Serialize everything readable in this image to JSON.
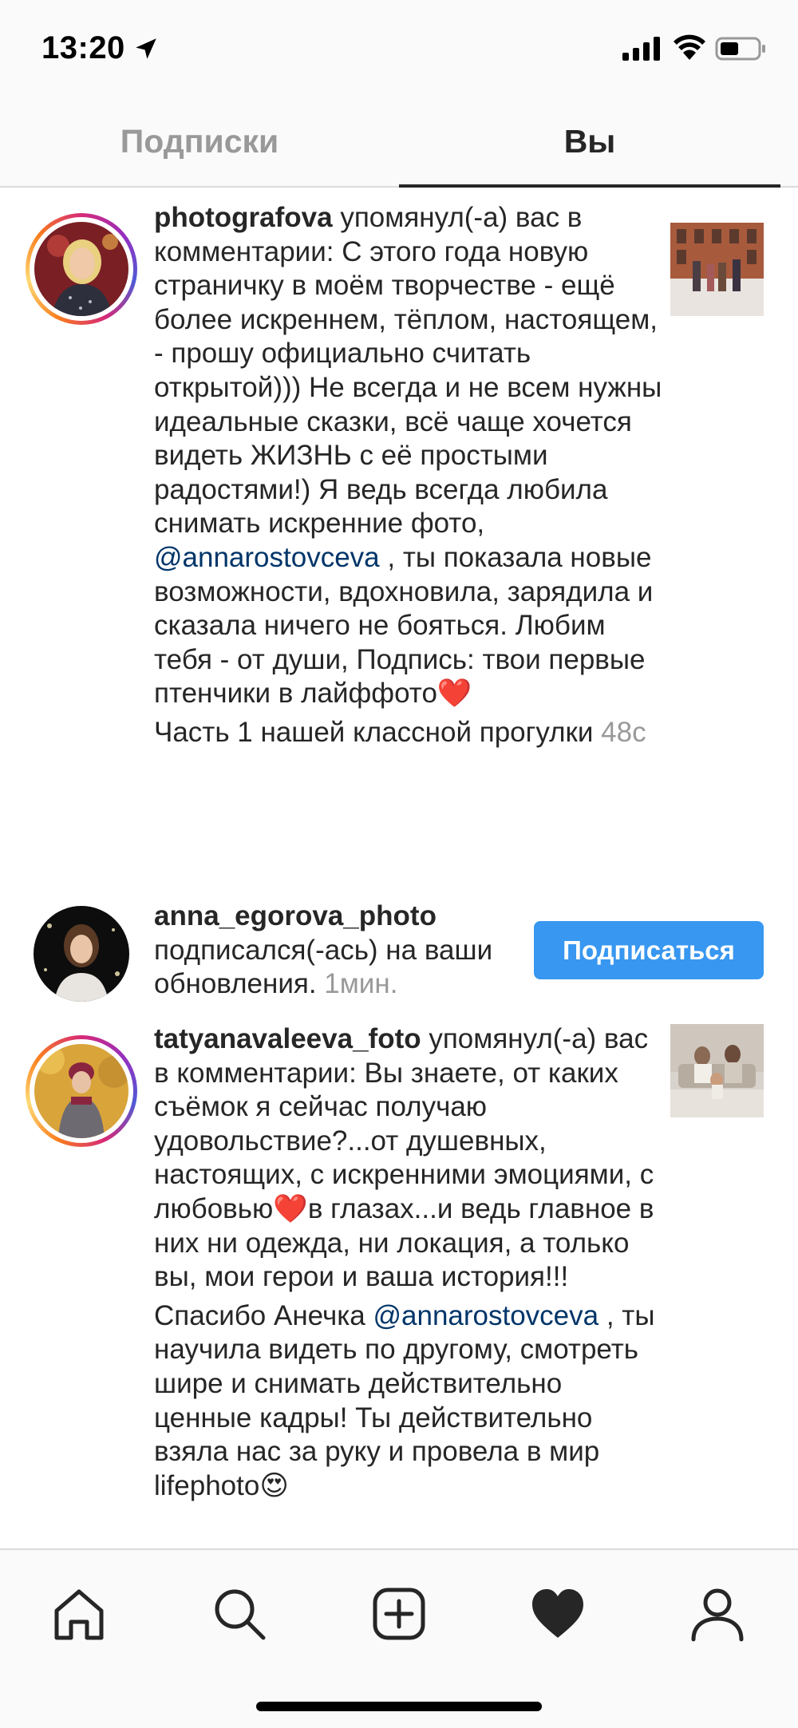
{
  "status_bar": {
    "time": "13:20"
  },
  "tabs": [
    {
      "label": "Подписки",
      "active": false
    },
    {
      "label": "Вы",
      "active": true
    }
  ],
  "activity": [
    {
      "username": "photografova",
      "action": "упомянул(-а) вас в комментарии:",
      "text_1": "С этого года новую страничку в моём творчестве - ещё более искреннем, тёплом, настоящем, - прошу официально считать открытой))) Не всегда и не всем нужны идеальные сказки, всё чаще хочется видеть ЖИЗНЬ с её простыми радостями!) Я ведь всегда любила снимать искренние фото,",
      "mention": "@annarostovceva",
      "text_2": ", ты показала новые возможности, вдохновила, зарядила и сказала ничего не бояться. Любим тебя - от души, Подпись: твои первые птенчики в лайффото",
      "emoji": "❤️",
      "text_3": "Часть 1 нашей классной прогулки",
      "time": "48с"
    },
    {
      "username": "anna_egorova_photo",
      "action": "подписался(-ась) на ваши обновления.",
      "time": "1мин.",
      "button_label": "Подписаться"
    },
    {
      "username": "tatyanavaleeva_foto",
      "action": "упомянул(-а) вас в комментарии:",
      "text_1": "Вы знаете, от каких съёмок я сейчас получаю удовольствие?...от душевных, настоящих, с искренними эмоциями, с любовью",
      "emoji_1": "❤️",
      "text_1b": "в глазах...и ведь главное в  них ни одежда, ни локация, а только вы, мои герои и ваша история!!!",
      "text_2a": "Спасибо Анечка",
      "mention": "@annarostovceva",
      "text_2b": ", ты научила видеть по другому, смотреть шире и снимать действительно ценные кадры! Ты действительно взяла нас за руку и провела в мир lifephoto",
      "emoji_2": "😍"
    }
  ],
  "bottom_nav": [
    "home-icon",
    "search-icon",
    "add-post-icon",
    "activity-heart-icon",
    "profile-icon"
  ],
  "colors": {
    "accent": "#3897f0",
    "mention": "#003569",
    "muted": "#999999",
    "heart": "#ed4956"
  }
}
